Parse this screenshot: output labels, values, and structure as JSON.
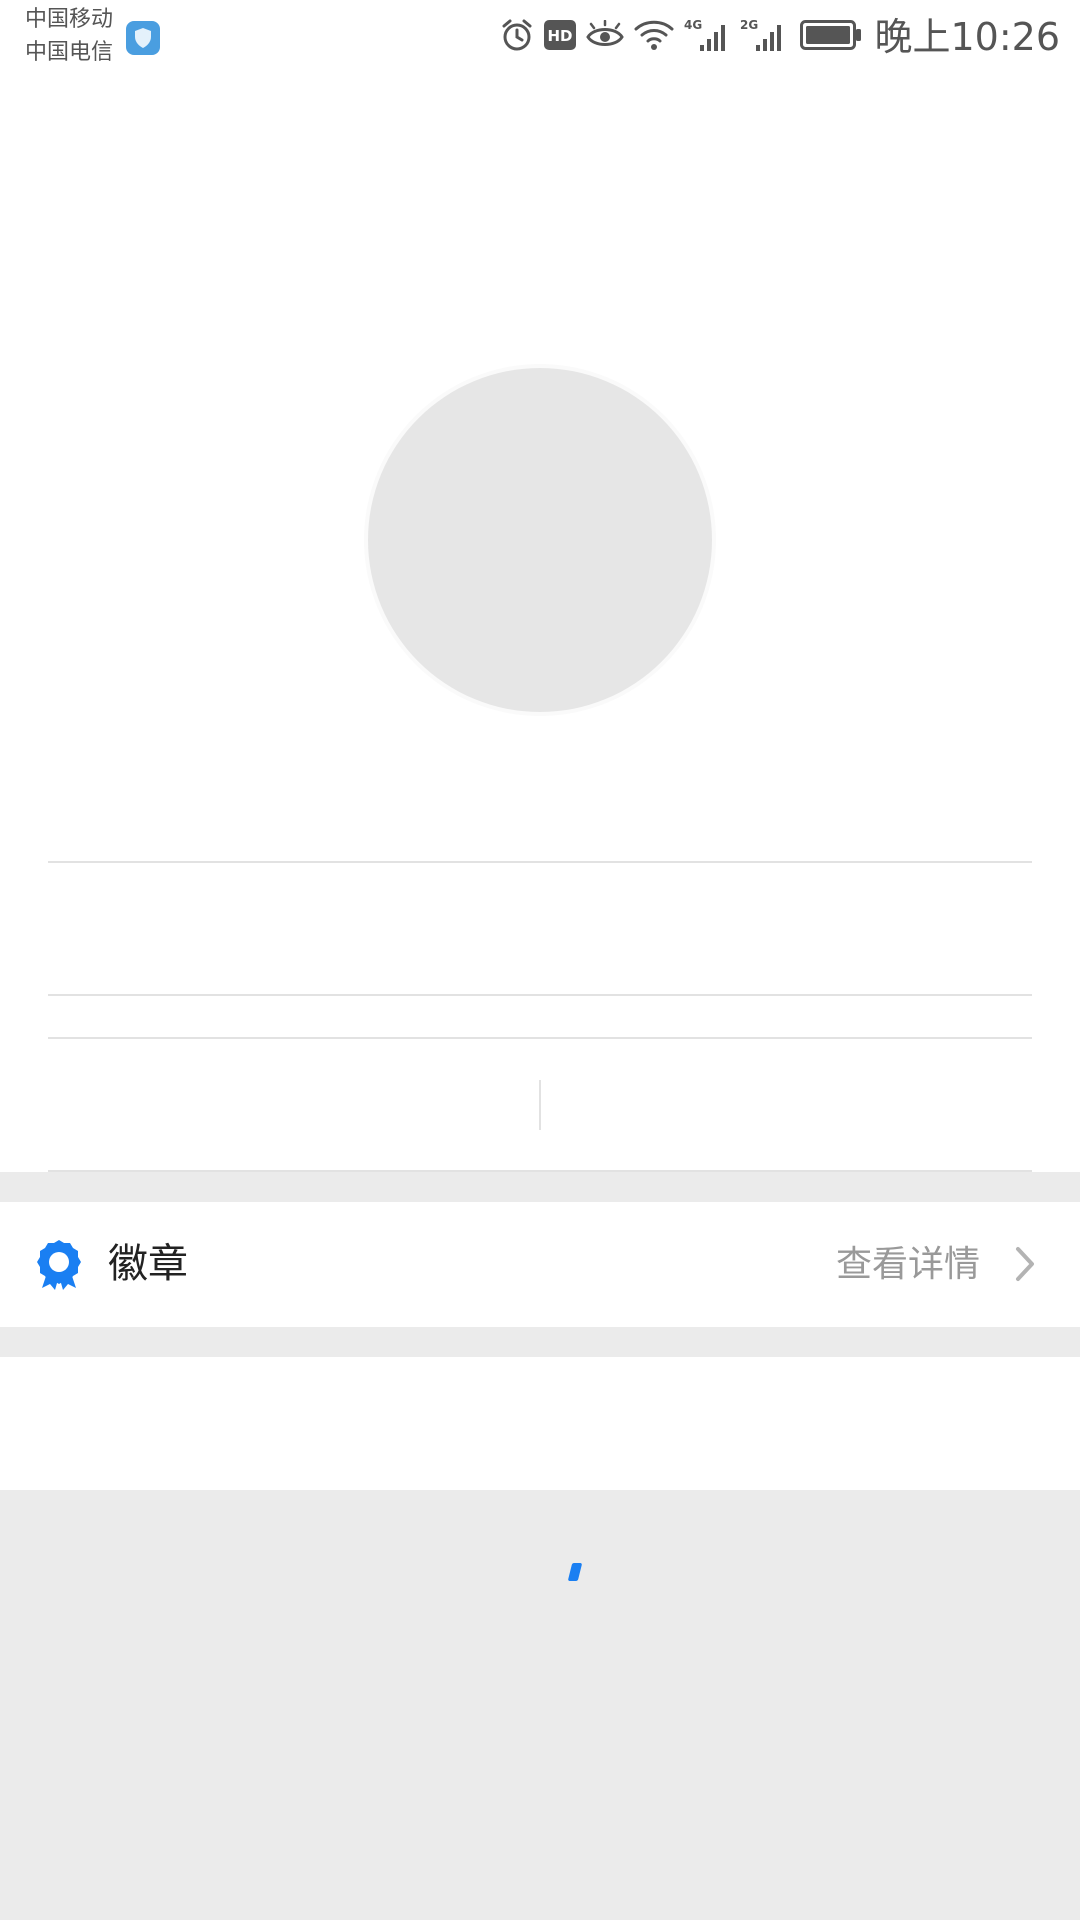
{
  "status_bar": {
    "carrier_1": "中国移动",
    "carrier_2": "中国电信",
    "time": "晚上10:26",
    "network_1": "4G",
    "network_2": "2G",
    "icons": [
      "alarm-icon",
      "hd-icon",
      "eye-icon",
      "wifi-icon",
      "signal-4g-icon",
      "signal-2g-icon",
      "battery-icon"
    ]
  },
  "badge": {
    "label": "徽章",
    "detail": "查看详情",
    "accent_color": "#1a7ff2"
  },
  "colors": {
    "avatar_placeholder": "#e6e6e6",
    "section_gap": "#ebebeb",
    "spinner": "#1a7ff2"
  }
}
